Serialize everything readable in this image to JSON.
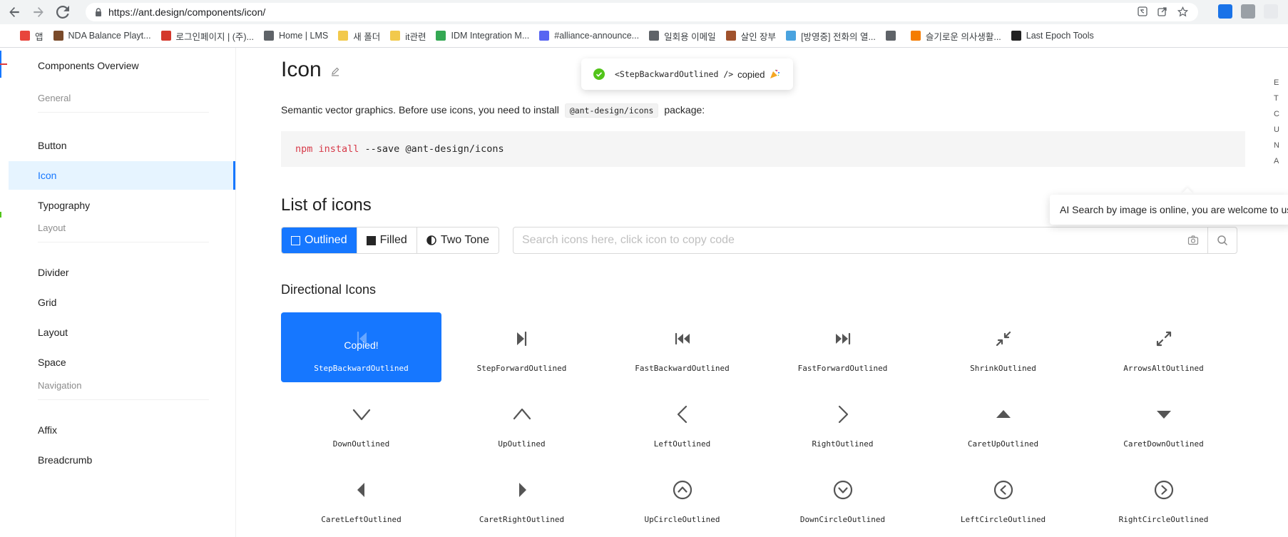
{
  "browser": {
    "url": "https://ant.design/components/icon/",
    "bookmarks": [
      {
        "label": "앱",
        "color": "#e8453c"
      },
      {
        "label": "NDA Balance Playt...",
        "color": "#7a4a2a"
      },
      {
        "label": "로그인페이지 | (주)...",
        "color": "#d4382c"
      },
      {
        "label": "Home | LMS",
        "color": "#5f6368"
      },
      {
        "label": "새 폴더",
        "color": "#f2c94c"
      },
      {
        "label": "it관련",
        "color": "#f2c94c"
      },
      {
        "label": "IDM Integration M...",
        "color": "#34a853"
      },
      {
        "label": "#alliance-announce...",
        "color": "#5865f2"
      },
      {
        "label": "일회용 이메일",
        "color": "#5f6368"
      },
      {
        "label": "살인 장부",
        "color": "#a0522d"
      },
      {
        "label": "[방영중] 전화의 열...",
        "color": "#4aa3df"
      },
      {
        "label": "",
        "color": "#5f6368"
      },
      {
        "label": "슬기로운 의사생활...",
        "color": "#f57c00"
      },
      {
        "label": "Last Epoch Tools",
        "color": "#222222"
      }
    ]
  },
  "sidebar": {
    "items": [
      {
        "label": "Components Overview",
        "type": "item",
        "active": false
      },
      {
        "label": "General",
        "type": "group"
      },
      {
        "label": "Button",
        "type": "item",
        "active": false
      },
      {
        "label": "Icon",
        "type": "item",
        "active": true
      },
      {
        "label": "Typography",
        "type": "item",
        "active": false
      },
      {
        "label": "Layout",
        "type": "group"
      },
      {
        "label": "Divider",
        "type": "item",
        "active": false
      },
      {
        "label": "Grid",
        "type": "item",
        "active": false
      },
      {
        "label": "Layout",
        "type": "item",
        "active": false
      },
      {
        "label": "Space",
        "type": "item",
        "active": false
      },
      {
        "label": "Navigation",
        "type": "group"
      },
      {
        "label": "Affix",
        "type": "item",
        "active": false
      },
      {
        "label": "Breadcrumb",
        "type": "item",
        "active": false
      }
    ]
  },
  "main": {
    "title": "Icon",
    "description_before": "Semantic vector graphics. Before use icons, you need to install",
    "description_code": "@ant-design/icons",
    "description_after": "package:",
    "code_keyword": "npm install",
    "code_rest": "--save @ant-design/icons",
    "list_title": "List of icons",
    "themes": [
      {
        "label": "Outlined",
        "active": true
      },
      {
        "label": "Filled",
        "active": false
      },
      {
        "label": "Two Tone",
        "active": false
      }
    ],
    "search_placeholder": "Search icons here, click icon to copy code",
    "group_title": "Directional Icons",
    "copied_label": "Copied!",
    "icons": [
      {
        "name": "StepBackwardOutlined",
        "icon": "step-backward-icon",
        "active": true
      },
      {
        "name": "StepForwardOutlined",
        "icon": "step-forward-icon"
      },
      {
        "name": "FastBackwardOutlined",
        "icon": "fast-backward-icon"
      },
      {
        "name": "FastForwardOutlined",
        "icon": "fast-forward-icon"
      },
      {
        "name": "ShrinkOutlined",
        "icon": "shrink-icon"
      },
      {
        "name": "ArrowsAltOutlined",
        "icon": "arrows-alt-icon"
      },
      {
        "name": "DownOutlined",
        "icon": "down-icon"
      },
      {
        "name": "UpOutlined",
        "icon": "up-icon"
      },
      {
        "name": "LeftOutlined",
        "icon": "left-icon"
      },
      {
        "name": "RightOutlined",
        "icon": "right-icon"
      },
      {
        "name": "CaretUpOutlined",
        "icon": "caret-up-icon"
      },
      {
        "name": "CaretDownOutlined",
        "icon": "caret-down-icon"
      },
      {
        "name": "CaretLeftOutlined",
        "icon": "caret-left-icon"
      },
      {
        "name": "CaretRightOutlined",
        "icon": "caret-right-icon"
      },
      {
        "name": "UpCircleOutlined",
        "icon": "up-circle-icon"
      },
      {
        "name": "DownCircleOutlined",
        "icon": "down-circle-icon"
      },
      {
        "name": "LeftCircleOutlined",
        "icon": "left-circle-icon"
      },
      {
        "name": "RightCircleOutlined",
        "icon": "right-circle-icon"
      }
    ]
  },
  "toast": {
    "code": "<StepBackwardOutlined />",
    "text": "copied"
  },
  "ai_tip": {
    "text": "AI Search by image is online, you are welcome to use"
  },
  "toc_letters": [
    "E",
    "T",
    "C",
    "U",
    "N",
    "A"
  ],
  "colors": {
    "primary": "#1677ff",
    "active_bg": "#e6f4ff",
    "success": "#52c41a"
  }
}
